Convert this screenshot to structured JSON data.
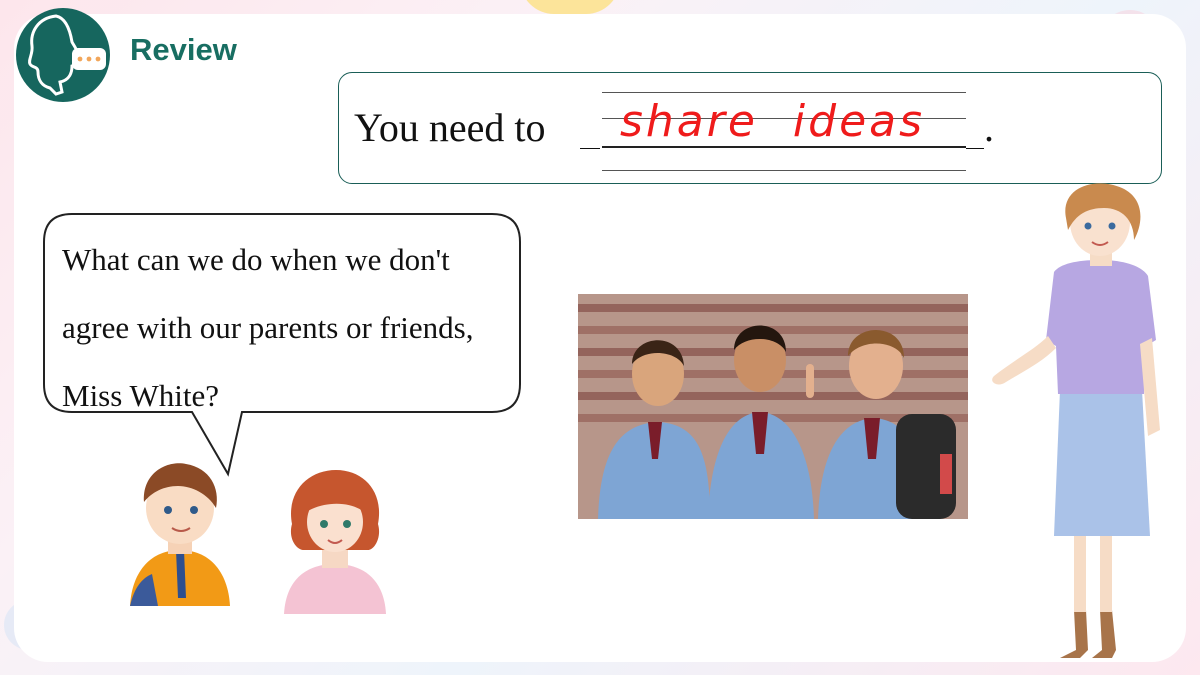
{
  "header": {
    "title": "Review"
  },
  "prompt": {
    "sentence_start": "You need to",
    "answer": "share ideas",
    "ending": "."
  },
  "speech_bubble": {
    "lines": [
      "What can we do when we don't",
      "agree with our parents or friends,",
      "Miss White?"
    ]
  },
  "colors": {
    "brand": "#16665e",
    "answer": "#ef1b1b",
    "box_border": "#1a5e57"
  },
  "icons": [
    "speaker-head-icon",
    "chat-dots-icon"
  ]
}
